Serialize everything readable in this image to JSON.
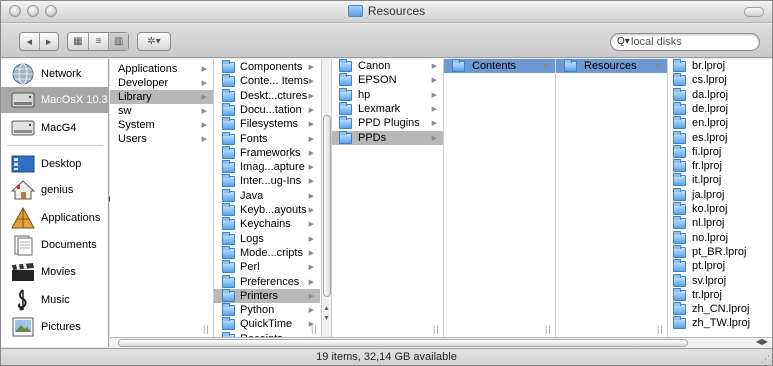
{
  "window": {
    "title": "Resources"
  },
  "toolbar": {
    "back_glyph": "◀",
    "forward_glyph": "▶",
    "view_icons_glyph": "▦",
    "view_list_glyph": "≡",
    "view_columns_glyph": "▥",
    "action_glyph": "✲▾",
    "search_icon_glyph": "Q▾",
    "search_placeholder": "local disks"
  },
  "sidebar": {
    "items": [
      {
        "label": "Network",
        "icon": "network-globe-icon"
      },
      {
        "label": "MacOsX 10.3",
        "icon": "hard-disk-icon",
        "selected": true
      },
      {
        "label": "MacG4",
        "icon": "hard-disk-icon"
      },
      {
        "label": "Desktop",
        "icon": "desktop-icon"
      },
      {
        "label": "genius",
        "icon": "home-icon"
      },
      {
        "label": "Applications",
        "icon": "applications-icon"
      },
      {
        "label": "Documents",
        "icon": "documents-icon"
      },
      {
        "label": "Movies",
        "icon": "movies-icon"
      },
      {
        "label": "Music",
        "icon": "music-icon"
      },
      {
        "label": "Pictures",
        "icon": "pictures-icon"
      }
    ]
  },
  "columns": [
    {
      "items": [
        "Applications",
        "Developer",
        "Library",
        "sw",
        "System",
        "Users"
      ],
      "selected": 2,
      "folder_icons": false
    },
    {
      "items": [
        "Components",
        "Conte... Items",
        "Deskt...ctures",
        "Docu...tation",
        "Filesystems",
        "Fonts",
        "Frameworks",
        "Imag...apture",
        "Inter...ug-Ins",
        "Java",
        "Keyb...ayouts",
        "Keychains",
        "Logs",
        "Mode...cripts",
        "Perl",
        "Preferences",
        "Printers",
        "Python",
        "QuickTime",
        "Receipts"
      ],
      "selected": 16,
      "folder_icons": true
    },
    {
      "items": [
        "Canon",
        "EPSON",
        "hp",
        "Lexmark",
        "PPD Plugins",
        "PPDs"
      ],
      "selected": 5,
      "folder_icons": true
    },
    {
      "items": [
        "Contents"
      ],
      "selected": 0,
      "folder_icons": true
    },
    {
      "items": [
        "Resources"
      ],
      "selected": 0,
      "folder_icons": true,
      "active": true
    },
    {
      "items": [
        "br.lproj",
        "cs.lproj",
        "da.lproj",
        "de.lproj",
        "en.lproj",
        "es.lproj",
        "fi.lproj",
        "fr.lproj",
        "it.lproj",
        "ja.lproj",
        "ko.lproj",
        "nl.lproj",
        "no.lproj",
        "pt_BR.lproj",
        "pt.lproj",
        "sv.lproj",
        "tr.lproj",
        "zh_CN.lproj",
        "zh_TW.lproj"
      ],
      "selected": -1,
      "folder_icons": true
    }
  ],
  "status": {
    "text": "19 items, 32,14 GB available"
  },
  "colors": {
    "selection_grey": "#b8b8b8",
    "selection_blue": "#6d98d1",
    "folder_blue": "#5aa2e8"
  }
}
